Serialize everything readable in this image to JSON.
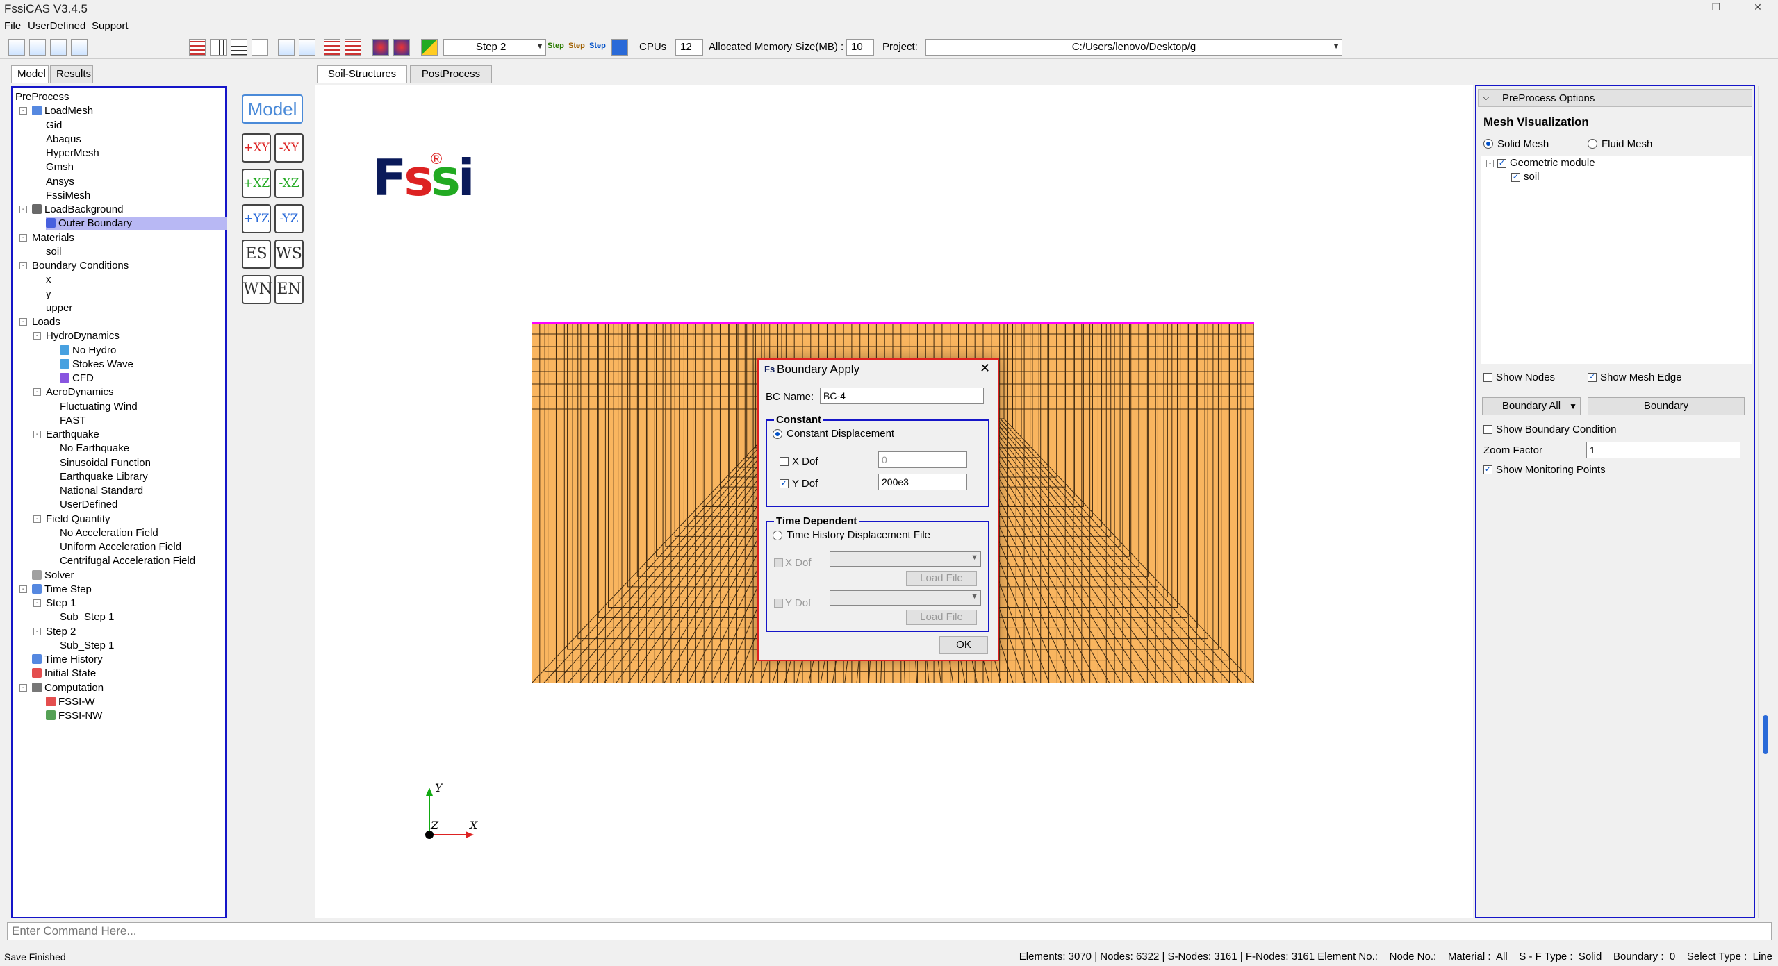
{
  "app": {
    "title": "FssiCAS V3.4.5",
    "logo_text": "Fs"
  },
  "menu": [
    "File",
    "UserDefined",
    "Support"
  ],
  "toolbar": {
    "step_value": "Step 2",
    "cpus_label": "CPUs",
    "cpus_value": "12",
    "memory_label": "Allocated Memory Size(MB) :",
    "memory_value": "10",
    "project_label": "Project:",
    "project_value": "C:/Users/lenovo/Desktop/g",
    "step_icon_1": "Step",
    "step_icon_2": "Step",
    "step_icon_3": "Step"
  },
  "left_tabs": [
    "Model",
    "Results"
  ],
  "tree": [
    {
      "label": "PreProcess",
      "level": 0
    },
    {
      "label": "LoadMesh",
      "level": 1,
      "exp": "-",
      "icon": "grid"
    },
    {
      "label": "Gid",
      "level": 2
    },
    {
      "label": "Abaqus",
      "level": 2
    },
    {
      "label": "HyperMesh",
      "level": 2
    },
    {
      "label": "Gmsh",
      "level": 2
    },
    {
      "label": "Ansys",
      "level": 2
    },
    {
      "label": "FssiMesh",
      "level": 2
    },
    {
      "label": "LoadBackground",
      "level": 1,
      "exp": "-",
      "icon": "funnel"
    },
    {
      "label": "Outer Boundary",
      "level": 2,
      "icon": "boundary",
      "selected": true
    },
    {
      "label": "Materials",
      "level": 1,
      "exp": "-"
    },
    {
      "label": "soil",
      "level": 2
    },
    {
      "label": "Boundary Conditions",
      "level": 1,
      "exp": "-"
    },
    {
      "label": "x",
      "level": 2
    },
    {
      "label": "y",
      "level": 2
    },
    {
      "label": "upper",
      "level": 2
    },
    {
      "label": "Loads",
      "level": 1,
      "exp": "-"
    },
    {
      "label": "HydroDynamics",
      "level": 2,
      "exp": "-"
    },
    {
      "label": "No Hydro",
      "level": 3,
      "icon": "hydro"
    },
    {
      "label": "Stokes Wave",
      "level": 3,
      "icon": "hydro"
    },
    {
      "label": "CFD",
      "level": 3,
      "icon": "cfd"
    },
    {
      "label": "AeroDynamics",
      "level": 2,
      "exp": "-"
    },
    {
      "label": "Fluctuating Wind",
      "level": 3
    },
    {
      "label": "FAST",
      "level": 3
    },
    {
      "label": "Earthquake",
      "level": 2,
      "exp": "-"
    },
    {
      "label": "No Earthquake",
      "level": 3
    },
    {
      "label": "Sinusoidal Function",
      "level": 3
    },
    {
      "label": "Earthquake Library",
      "level": 3
    },
    {
      "label": "National Standard",
      "level": 3
    },
    {
      "label": "UserDefined",
      "level": 3
    },
    {
      "label": "Field Quantity",
      "level": 2,
      "exp": "-"
    },
    {
      "label": "No Acceleration Field",
      "level": 3
    },
    {
      "label": "Uniform Acceleration Field",
      "level": 3
    },
    {
      "label": "Centrifugal Acceleration Field",
      "level": 3
    },
    {
      "label": "Solver",
      "level": 1,
      "icon": "solver"
    },
    {
      "label": "Time Step",
      "level": 1,
      "exp": "-",
      "icon": "clock"
    },
    {
      "label": "Step 1",
      "level": 2,
      "exp": "-"
    },
    {
      "label": "Sub_Step 1",
      "level": 3
    },
    {
      "label": "Step 2",
      "level": 2,
      "exp": "-"
    },
    {
      "label": "Sub_Step 1",
      "level": 3
    },
    {
      "label": "Time History",
      "level": 1,
      "icon": "history"
    },
    {
      "label": "Initial State",
      "level": 1,
      "icon": "initial"
    },
    {
      "label": "Computation",
      "level": 1,
      "exp": "-",
      "icon": "comp"
    },
    {
      "label": "FSSI-W",
      "level": 2,
      "icon": "fssiw"
    },
    {
      "label": "FSSI-NW",
      "level": 2,
      "icon": "fssinw"
    }
  ],
  "center_tabs": [
    "Soil-Structures",
    "PostProcess"
  ],
  "view_buttons": {
    "model": "Model",
    "btns": [
      [
        "+XY",
        "-XY"
      ],
      [
        "+XZ",
        "-XZ"
      ],
      [
        "+YZ",
        "-YZ"
      ],
      [
        "ES",
        "WS"
      ],
      [
        "WN",
        "EN"
      ]
    ]
  },
  "canvas_logo": {
    "text": "Fssi",
    "reg": "®"
  },
  "axis": {
    "y": "Y",
    "z": "Z",
    "x": "X"
  },
  "dialog": {
    "title": "Boundary Apply",
    "bc_name_label": "BC Name:",
    "bc_name_value": "BC-4",
    "constant_title": "Constant",
    "constant_displacement": "Constant Displacement",
    "x_dof_label": "X Dof",
    "x_dof_value": "0",
    "y_dof_label": "Y Dof",
    "y_dof_value": "200e3",
    "time_title": "Time Dependent",
    "time_history": "Time History Displacement File",
    "td_x_dof": "X Dof",
    "td_y_dof": "Y Dof",
    "load_file_1": "Load File",
    "load_file_2": "Load File",
    "ok": "OK"
  },
  "right_panel": {
    "header": "PreProcess Options",
    "section": "Mesh Visualization",
    "solid": "Solid Mesh",
    "fluid": "Fluid Mesh",
    "tree_root": "Geometric module",
    "tree_child": "soil",
    "show_nodes": "Show Nodes",
    "show_mesh_edge": "Show Mesh Edge",
    "boundary_all": "Boundary All",
    "boundary_btn": "Boundary",
    "show_bc": "Show Boundary Condition",
    "zoom_label": "Zoom Factor",
    "zoom_value": "1",
    "show_mp": "Show Monitoring Points"
  },
  "command": {
    "placeholder": "Enter Command Here..."
  },
  "status": {
    "left": "Save Finished",
    "right": "Elements: 3070 | Nodes: 6322 | S-Nodes: 3161 | F-Nodes: 3161 Element No.:    Node No.:    Material :  All    S - F Type :  Solid    Boundary :  0    Select Type :  Line"
  },
  "colors": {
    "accent": "#1515c8",
    "mesh_fill": "#f9b55f",
    "mesh_line": "#2a1a08",
    "top_boundary": "#ff00ff",
    "dialog_border": "#e02020"
  }
}
